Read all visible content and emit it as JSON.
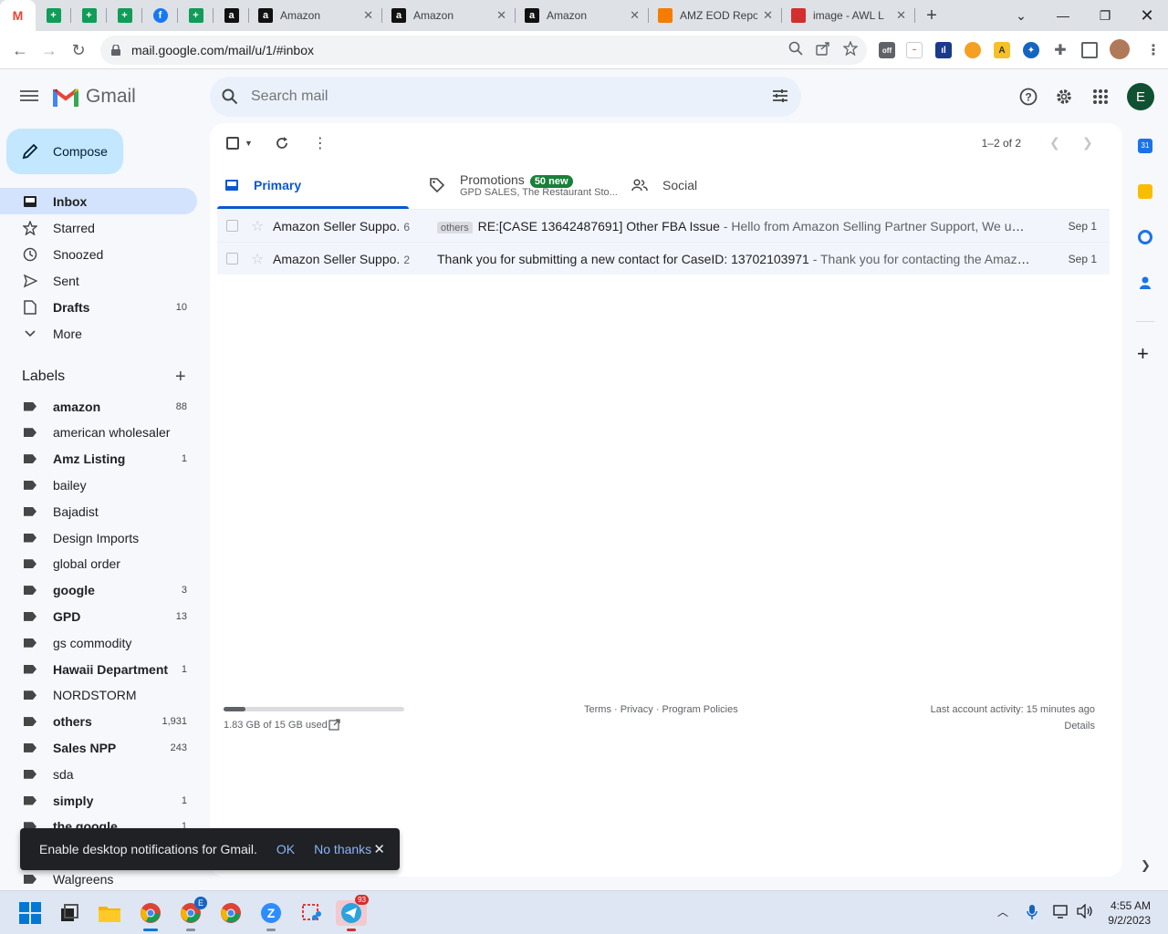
{
  "browser": {
    "tabs": [
      {
        "title": "",
        "icon": "gmail-icon",
        "color": "#ea4335",
        "active": true
      },
      {
        "title": "",
        "icon": "sheets-icon",
        "color": "#0f9d58"
      },
      {
        "title": "",
        "icon": "sheets-icon",
        "color": "#0f9d58"
      },
      {
        "title": "",
        "icon": "sheets-icon",
        "color": "#0f9d58"
      },
      {
        "title": "",
        "icon": "facebook-icon",
        "color": "#1877f2"
      },
      {
        "title": "",
        "icon": "sheets-icon",
        "color": "#0f9d58"
      },
      {
        "title": "",
        "icon": "amazon-icon",
        "color": "#111111"
      },
      {
        "title": "Amazon",
        "icon": "amazon-icon",
        "color": "#111111"
      },
      {
        "title": "Amazon",
        "icon": "amazon-icon",
        "color": "#111111"
      },
      {
        "title": "Amazon",
        "icon": "amazon-icon",
        "color": "#111111"
      },
      {
        "title": "AMZ EOD Repo",
        "icon": "amz-eod-icon",
        "color": "#f57c00"
      },
      {
        "title": "image - AWL L",
        "icon": "awl-icon",
        "color": "#d32f2f"
      }
    ],
    "url": "mail.google.com/mail/u/1/#inbox"
  },
  "header": {
    "app_name": "Gmail",
    "search_placeholder": "Search mail",
    "avatar_letter": "E"
  },
  "sidebar": {
    "compose_label": "Compose",
    "nav": [
      {
        "label": "Inbox",
        "count": "",
        "icon": "inbox-icon",
        "active": true,
        "bold": true
      },
      {
        "label": "Starred",
        "count": "",
        "icon": "star-icon"
      },
      {
        "label": "Snoozed",
        "count": "",
        "icon": "clock-icon"
      },
      {
        "label": "Sent",
        "count": "",
        "icon": "send-icon"
      },
      {
        "label": "Drafts",
        "count": "10",
        "icon": "draft-icon",
        "bold": true
      },
      {
        "label": "More",
        "count": "",
        "icon": "chevron-down-icon"
      }
    ],
    "labels_heading": "Labels",
    "labels": [
      {
        "label": "amazon",
        "count": "88",
        "bold": true
      },
      {
        "label": "american wholesaler",
        "count": ""
      },
      {
        "label": "Amz Listing",
        "count": "1",
        "bold": true
      },
      {
        "label": "bailey",
        "count": ""
      },
      {
        "label": "Bajadist",
        "count": ""
      },
      {
        "label": "Design Imports",
        "count": ""
      },
      {
        "label": "global order",
        "count": ""
      },
      {
        "label": "google",
        "count": "3",
        "bold": true
      },
      {
        "label": "GPD",
        "count": "13",
        "bold": true
      },
      {
        "label": "gs commodity",
        "count": ""
      },
      {
        "label": "Hawaii Department",
        "count": "1",
        "bold": true
      },
      {
        "label": "NORDSTORM",
        "count": ""
      },
      {
        "label": "others",
        "count": "1,931",
        "bold": true
      },
      {
        "label": "Sales NPP",
        "count": "243",
        "bold": true
      },
      {
        "label": "sda",
        "count": ""
      },
      {
        "label": "simply",
        "count": "1",
        "bold": true
      },
      {
        "label": "the google",
        "count": "1",
        "bold": true
      },
      {
        "label": "",
        "count": ""
      },
      {
        "label": "Walgreens",
        "count": ""
      }
    ]
  },
  "main": {
    "pager_text": "1–2 of 2",
    "tabs": [
      {
        "label": "Primary",
        "icon": "inbox-icon",
        "active": true
      },
      {
        "label": "Promotions",
        "badge": "50 new",
        "sub": "GPD SALES, The Restaurant Sto...",
        "icon": "tag-icon"
      },
      {
        "label": "Social",
        "icon": "people-icon"
      }
    ],
    "emails": [
      {
        "sender": "Amazon Seller Suppo.",
        "count": "6",
        "tag": "others",
        "subject": "RE:[CASE 13642487691] Other FBA Issue",
        "snippet": " - Hello from Amazon Selling Partner Support, We understand ...",
        "date": "Sep 1"
      },
      {
        "sender": "Amazon Seller Suppo.",
        "count": "2",
        "tag": "",
        "subject": "Thank you for submitting a new contact for CaseID: 13702103971",
        "snippet": " - Thank you for contacting the Amazon Devel...",
        "date": "Sep 1"
      }
    ],
    "footer": {
      "storage": "1.83 GB of 15 GB used",
      "storage_fraction": 0.122,
      "links": "Terms · Privacy · Program Policies",
      "activity": "Last account activity: 15 minutes ago",
      "details": "Details"
    }
  },
  "snackbar": {
    "message": "Enable desktop notifications for Gmail.",
    "ok": "OK",
    "no_thanks": "No thanks"
  },
  "taskbar": {
    "telegram_badge": "93",
    "chrome_profile_badge": "E",
    "time": "4:55 AM",
    "date": "9/2/2023"
  }
}
